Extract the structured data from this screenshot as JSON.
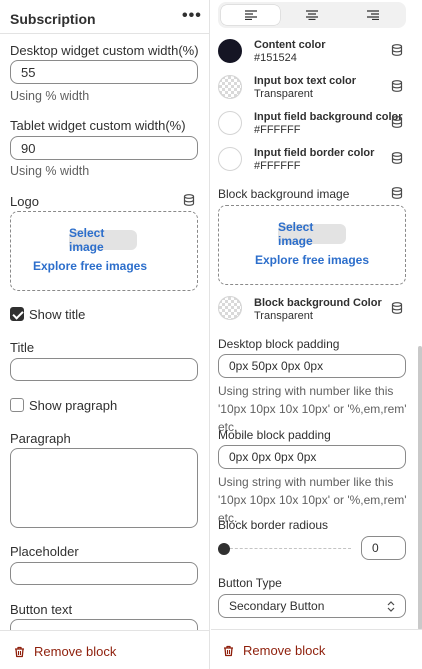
{
  "left": {
    "header": {
      "title": "Subscription",
      "more": "•••"
    },
    "desktop_width": {
      "label": "Desktop widget custom width(%)",
      "value": "55",
      "help": "Using % width"
    },
    "tablet_width": {
      "label": "Tablet widget custom width(%)",
      "value": "90",
      "help": "Using % width"
    },
    "logo": {
      "label": "Logo",
      "select_label": "Select image",
      "explore_label": "Explore free images"
    },
    "show_title": {
      "label": "Show title",
      "checked": true
    },
    "title": {
      "label": "Title",
      "value": ""
    },
    "show_paragraph": {
      "label": "Show pragraph",
      "checked": false
    },
    "paragraph": {
      "label": "Paragraph",
      "value": ""
    },
    "placeholder": {
      "label": "Placeholder",
      "value": ""
    },
    "button_text": {
      "label": "Button text",
      "value": ""
    },
    "remove_label": "Remove block"
  },
  "right": {
    "alignment": {
      "options": [
        "left",
        "center",
        "right"
      ],
      "selected": "left"
    },
    "colors": [
      {
        "name": "Content color",
        "value": "#151524",
        "swatch": "#151524"
      },
      {
        "name": "Input box text color",
        "value": "Transparent",
        "swatch": "transparent"
      },
      {
        "name": "Input field background color",
        "value": "#FFFFFF",
        "swatch": "#FFFFFF"
      },
      {
        "name": "Input field border color",
        "value": "#FFFFFF",
        "swatch": "#FFFFFF"
      }
    ],
    "bg_image": {
      "label": "Block background image",
      "select_label": "Select image",
      "explore_label": "Explore free images"
    },
    "bg_color": {
      "name": "Block background Color",
      "value": "Transparent"
    },
    "desktop_padding": {
      "label": "Desktop block padding",
      "value": "0px 50px 0px 0px",
      "help": "Using string with number like this '10px 10px 10x 10px' or '%,em,rem' etc."
    },
    "mobile_padding": {
      "label": "Mobile block padding",
      "value": "0px 0px 0px 0px",
      "help": "Using string with number like this '10px 10px 10x 10px' or '%,em,rem' etc."
    },
    "border_radius": {
      "label": "Block border radious",
      "value": "0",
      "slider_fraction": 0
    },
    "button_type": {
      "label": "Button Type",
      "value": "Secondary Button"
    },
    "remove_label": "Remove block"
  },
  "icons": {
    "database": "database-icon",
    "trash": "trash-icon",
    "more": "more-horizontal-icon",
    "chevron": "chevron-updown-icon"
  },
  "colors": {
    "link": "#2c6ecb",
    "critical": "#8e1f0b",
    "text": "#303030"
  }
}
